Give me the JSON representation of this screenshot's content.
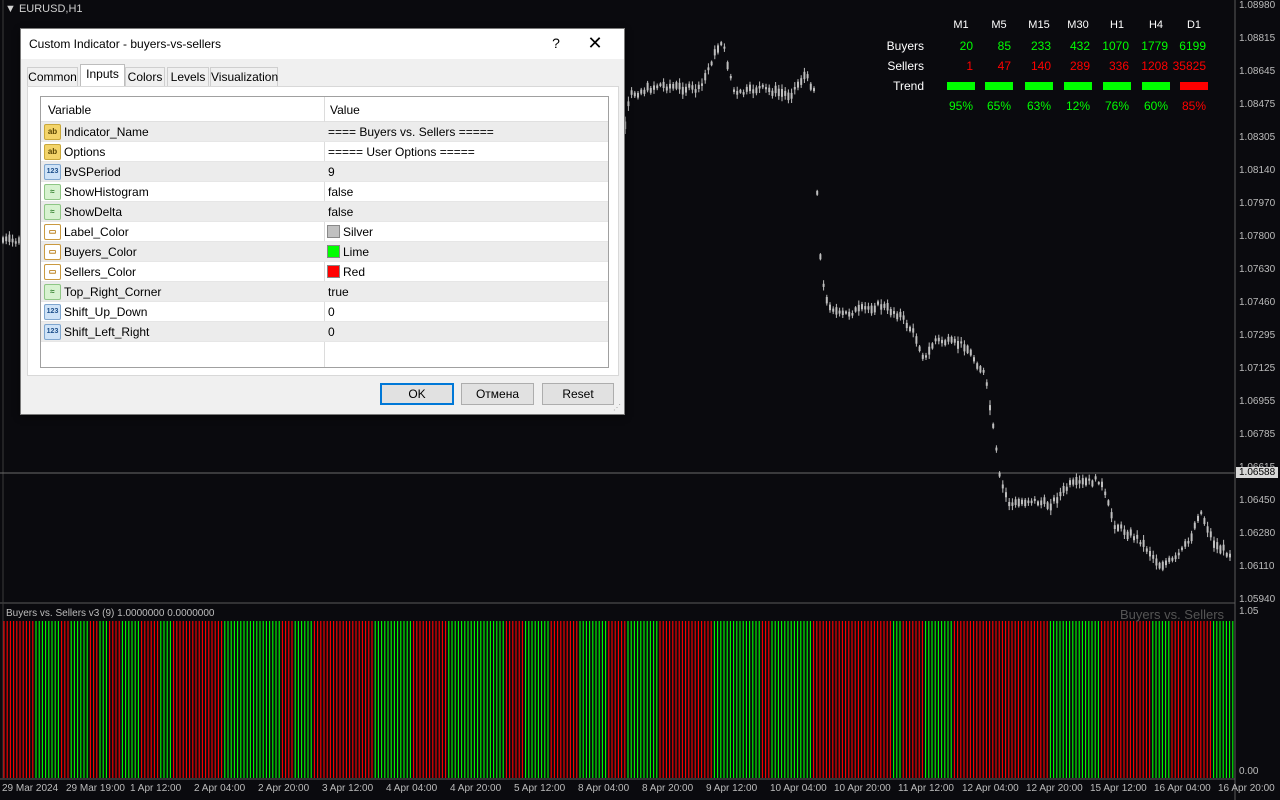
{
  "chart": {
    "title": "EURUSD,H1",
    "prices": [
      "1.08980",
      "1.08815",
      "1.08645",
      "1.08475",
      "1.08305",
      "1.08140",
      "1.07970",
      "1.07800",
      "1.07630",
      "1.07460",
      "1.07295",
      "1.07125",
      "1.06955",
      "1.06785",
      "1.06615",
      "1.06450",
      "1.06280",
      "1.06110",
      "1.05940"
    ],
    "current_price": "1.06588",
    "dates": [
      "29 Mar 2024",
      "29 Mar 19:00",
      "1 Apr 12:00",
      "2 Apr 04:00",
      "2 Apr 20:00",
      "3 Apr 12:00",
      "4 Apr 04:00",
      "4 Apr 20:00",
      "5 Apr 12:00",
      "8 Apr 04:00",
      "8 Apr 20:00",
      "9 Apr 12:00",
      "10 Apr 04:00",
      "10 Apr 20:00",
      "11 Apr 12:00",
      "12 Apr 04:00",
      "12 Apr 20:00",
      "15 Apr 12:00",
      "16 Apr 04:00",
      "16 Apr 20:00"
    ],
    "bull_color": "#00ff00",
    "bear_color": "#ff0000",
    "candle_color": "#bfbfbf"
  },
  "subwindow": {
    "title": "Buyers vs. Sellers v3 (9) 1.0000000 0.0000000",
    "watermark": "Buyers vs. Sellers",
    "scale_top": "1.05",
    "scale_bottom": "0.00"
  },
  "dashboard": {
    "timeframes": [
      "M1",
      "M5",
      "M15",
      "M30",
      "H1",
      "H4",
      "D1"
    ],
    "buyers_label": "Buyers",
    "sellers_label": "Sellers",
    "trend_label": "Trend",
    "buyers": [
      "20",
      "85",
      "233",
      "432",
      "1070",
      "1779",
      "6199"
    ],
    "sellers": [
      "1",
      "47",
      "140",
      "289",
      "336",
      "1208",
      "35825"
    ],
    "trend": [
      "up",
      "up",
      "up",
      "up",
      "up",
      "up",
      "down"
    ],
    "percent": [
      "95%",
      "65%",
      "63%",
      "12%",
      "76%",
      "60%",
      "85%"
    ]
  },
  "dialog": {
    "title": "Custom Indicator - buyers-vs-sellers",
    "help": "?",
    "close": "✕",
    "tabs": [
      "Common",
      "Inputs",
      "Colors",
      "Levels",
      "Visualization"
    ],
    "columns": {
      "variable": "Variable",
      "value": "Value"
    },
    "rows": [
      {
        "type": "string",
        "name": "Indicator_Name",
        "value": "==== Buyers vs. Sellers ====="
      },
      {
        "type": "string",
        "name": "Options",
        "value": "===== User Options ====="
      },
      {
        "type": "int",
        "name": "BvSPeriod",
        "value": "9"
      },
      {
        "type": "bool",
        "name": "ShowHistogram",
        "value": "false"
      },
      {
        "type": "bool",
        "name": "ShowDelta",
        "value": "false"
      },
      {
        "type": "color",
        "name": "Label_Color",
        "value": "Silver",
        "swatch": "#c0c0c0"
      },
      {
        "type": "color",
        "name": "Buyers_Color",
        "value": "Lime",
        "swatch": "#00ff00"
      },
      {
        "type": "color",
        "name": "Sellers_Color",
        "value": "Red",
        "swatch": "#ff0000"
      },
      {
        "type": "bool",
        "name": "Top_Right_Corner",
        "value": "true"
      },
      {
        "type": "int",
        "name": "Shift_Up_Down",
        "value": "0"
      },
      {
        "type": "int",
        "name": "Shift_Left_Right",
        "value": "0"
      }
    ],
    "icons": {
      "string": "ab",
      "int": "123",
      "bool": "≈",
      "color": "▭"
    },
    "buttons": {
      "ok": "OK",
      "cancel": "Отмена",
      "reset": "Reset"
    }
  }
}
